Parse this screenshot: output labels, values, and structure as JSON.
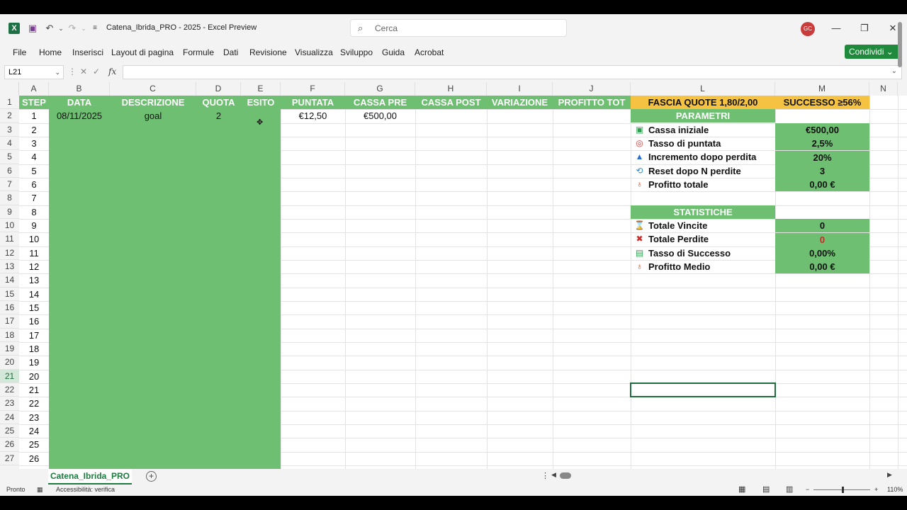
{
  "window": {
    "title": "Catena_Ibrida_PRO - 2025  -  Excel Preview",
    "search_placeholder": "Cerca",
    "avatar_initials": "GC",
    "share_label": "Condividi ⌄"
  },
  "ribbon": {
    "tabs": [
      "File",
      "Home",
      "Inserisci",
      "Layout di pagina",
      "Formule",
      "Dati",
      "Revisione",
      "Visualizza",
      "Sviluppo",
      "Guida",
      "Acrobat"
    ]
  },
  "formula_bar": {
    "name_box": "L21",
    "formula": ""
  },
  "columns": [
    "A",
    "B",
    "C",
    "D",
    "E",
    "F",
    "G",
    "H",
    "I",
    "J",
    "L",
    "M",
    "N"
  ],
  "rows": [
    "1",
    "2",
    "3",
    "4",
    "5",
    "6",
    "7",
    "8",
    "9",
    "10",
    "11",
    "12",
    "13",
    "14",
    "15",
    "16",
    "17",
    "18",
    "19",
    "20",
    "21",
    "22",
    "23",
    "24",
    "25",
    "26",
    "27"
  ],
  "table": {
    "headers": [
      "STEP",
      "DATA",
      "DESCRIZIONE",
      "QUOTA",
      "ESITO",
      "PUNTATA",
      "CASSA PRE",
      "CASSA POST",
      "VARIAZIONE",
      "PROFITTO TOT"
    ],
    "steps": [
      "1",
      "2",
      "3",
      "4",
      "5",
      "6",
      "7",
      "8",
      "9",
      "10",
      "11",
      "12",
      "13",
      "14",
      "15",
      "16",
      "17",
      "18",
      "19",
      "20",
      "21",
      "22",
      "23",
      "24",
      "25",
      "26"
    ],
    "row1": {
      "data": "08/11/2025",
      "descrizione": "goal",
      "quota": "2",
      "puntata": "€12,50",
      "cassa_pre": "€500,00"
    }
  },
  "panel": {
    "fascia": "FASCIA QUOTE 1,80/2,00",
    "successo": "SUCCESSO ≥56%",
    "parametri_title": "PARAMETRI",
    "parametri": [
      {
        "label": "Cassa iniziale",
        "value": "€500,00",
        "icon": "cash-icon"
      },
      {
        "label": "Tasso di puntata",
        "value": "2,5%",
        "icon": "target-icon"
      },
      {
        "label": "Incremento dopo perdita",
        "value": "20%",
        "icon": "up-arrow-icon"
      },
      {
        "label": "Reset dopo N perdite",
        "value": "3",
        "icon": "reset-icon"
      },
      {
        "label": "Profitto totale",
        "value": "0,00 €",
        "icon": "money-bag-icon"
      }
    ],
    "statistiche_title": "STATISTICHE",
    "statistiche": [
      {
        "label": "Totale Vincite",
        "value": "0",
        "icon": "trophy-icon"
      },
      {
        "label": "Totale Perdite",
        "value": "0",
        "icon": "cross-icon"
      },
      {
        "label": "Tasso di Successo",
        "value": "0,00%",
        "icon": "chart-icon"
      },
      {
        "label": "Profitto Medio",
        "value": "0,00 €",
        "icon": "money-bag-icon"
      }
    ]
  },
  "sheet_tab": "Catena_Ibrida_PRO",
  "status": {
    "ready": "Pronto",
    "accessibility": "Accessibilità: verifica",
    "zoom": "110%"
  }
}
